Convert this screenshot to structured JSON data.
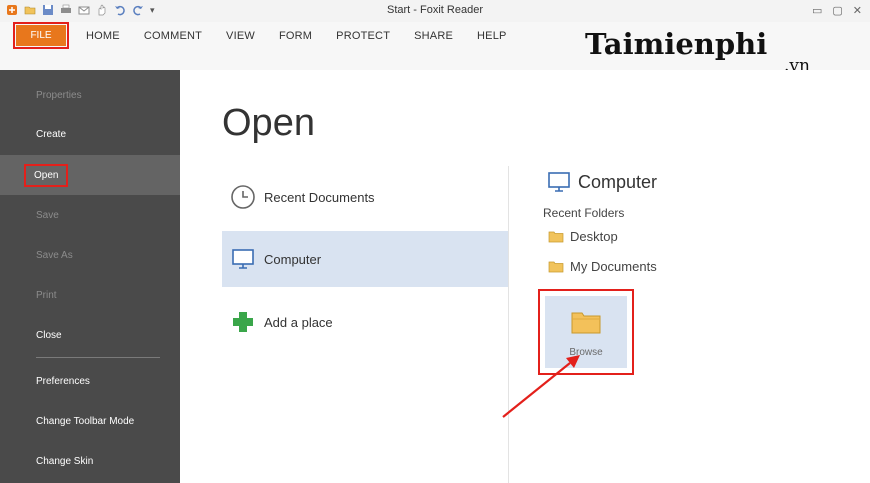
{
  "window": {
    "title": "Start - Foxit Reader"
  },
  "ribbon": {
    "file_tab": "FILE",
    "tabs": [
      "HOME",
      "COMMENT",
      "VIEW",
      "FORM",
      "PROTECT",
      "SHARE",
      "HELP"
    ]
  },
  "watermark": {
    "brand": "Taimienphi",
    "suffix": ".vn"
  },
  "sidebar": {
    "items": [
      {
        "label": "Properties"
      },
      {
        "label": "Create"
      },
      {
        "label": "Open"
      },
      {
        "label": "Save"
      },
      {
        "label": "Save As"
      },
      {
        "label": "Print"
      },
      {
        "label": "Close"
      },
      {
        "label": "Preferences"
      },
      {
        "label": "Change Toolbar Mode"
      },
      {
        "label": "Change Skin"
      }
    ]
  },
  "main": {
    "heading": "Open",
    "places": [
      {
        "label": "Recent Documents",
        "icon": "clock-icon"
      },
      {
        "label": "Computer",
        "icon": "monitor-icon"
      },
      {
        "label": "Add a place",
        "icon": "plus-icon"
      }
    ],
    "right_panel": {
      "title": "Computer",
      "recent_folders_label": "Recent Folders",
      "folders": [
        "Desktop",
        "My Documents"
      ],
      "browse_label": "Browse"
    }
  },
  "colors": {
    "sidebar_bg": "#4a4a4a",
    "file_tab": "#e8771c",
    "highlight_box": "#e3201b",
    "selection": "#d9e3f1"
  }
}
